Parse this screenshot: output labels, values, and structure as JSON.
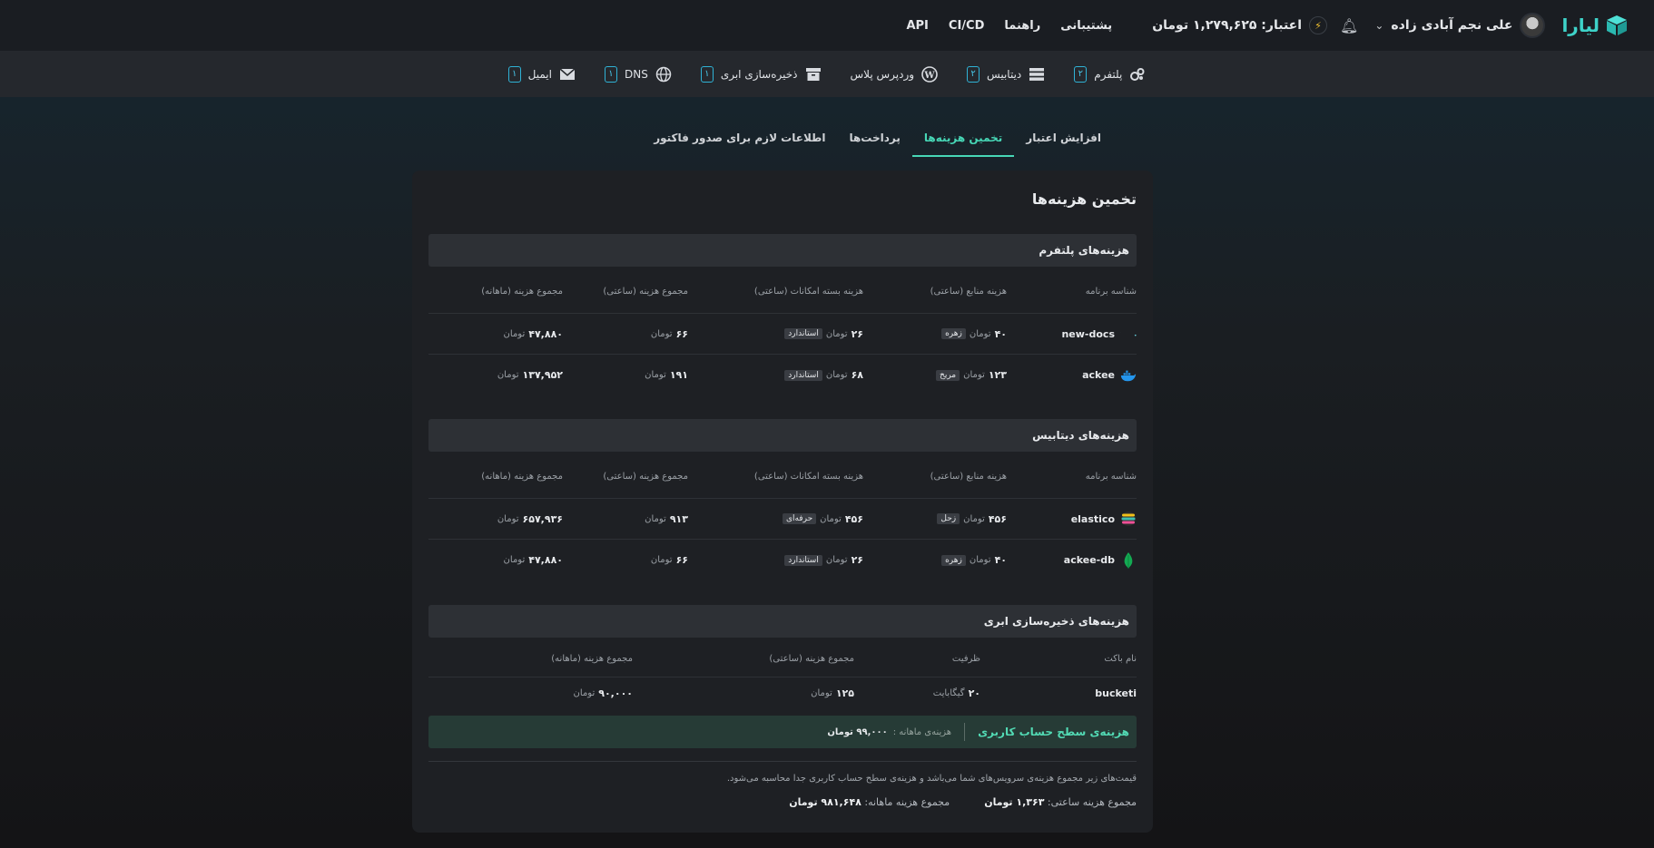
{
  "topbar": {
    "brand": "لیارا",
    "user_name": "علی نجم آبادی زاده",
    "credit": "اعتبار: ۱,۲۷۹,۶۲۵ تومان",
    "links": [
      "پشتیبانی",
      "راهنما",
      "CI/CD",
      "API"
    ]
  },
  "services": [
    {
      "label": "پلتفرم",
      "count": "۲",
      "icon": "cogs-icon"
    },
    {
      "label": "دیتابیس",
      "count": "۲",
      "icon": "database-icon"
    },
    {
      "label": "وردپرس پلاس",
      "count": "",
      "icon": "wordpress-icon"
    },
    {
      "label": "ذخیره‌سازی ابری",
      "count": "۱",
      "icon": "archive-icon"
    },
    {
      "label": "DNS",
      "count": "۱",
      "icon": "globe-icon"
    },
    {
      "label": "ایمیل",
      "count": "۱",
      "icon": "mail-icon"
    }
  ],
  "tabs": [
    {
      "label": "افزایش اعتبار",
      "active": false
    },
    {
      "label": "تخمین هزینه‌ها",
      "active": true
    },
    {
      "label": "پرداخت‌ها",
      "active": false
    },
    {
      "label": "اطلاعات لازم برای صدور فاکتور",
      "active": false
    }
  ],
  "card_title": "تخمین هزینه‌ها",
  "headers": {
    "app": "شناسه برنامه",
    "resource": "هزینه منابع (ساعتی)",
    "package": "هزینه بسته امکانات (ساعتی)",
    "hourly_total": "مجموع هزینه (ساعتی)",
    "monthly_total": "مجموع هزینه (ماهانه)"
  },
  "currency": "تومان",
  "platform": {
    "title": "هزینه‌های پلتفرم",
    "rows": [
      {
        "app": "new-docs",
        "icon": "nextjs-icon",
        "resource": "۴۰",
        "resource_plan": "زهره",
        "package": "۲۶",
        "package_plan": "استاندارد",
        "hourly": "۶۶",
        "monthly": "۴۷,۸۸۰"
      },
      {
        "app": "ackee",
        "icon": "docker-icon",
        "resource": "۱۲۳",
        "resource_plan": "مریخ",
        "package": "۶۸",
        "package_plan": "استاندارد",
        "hourly": "۱۹۱",
        "monthly": "۱۳۷,۹۵۲"
      }
    ]
  },
  "database": {
    "title": "هزینه‌های دیتابیس",
    "rows": [
      {
        "app": "elastico",
        "icon": "elastic-icon",
        "resource": "۴۵۶",
        "resource_plan": "زحل",
        "package": "۴۵۶",
        "package_plan": "حرفه‌ای",
        "hourly": "۹۱۳",
        "monthly": "۶۵۷,۹۳۶"
      },
      {
        "app": "ackee-db",
        "icon": "mongodb-icon",
        "resource": "۴۰",
        "resource_plan": "زهره",
        "package": "۲۶",
        "package_plan": "استاندارد",
        "hourly": "۶۶",
        "monthly": "۴۷,۸۸۰"
      }
    ]
  },
  "storage": {
    "title": "هزینه‌های ذخیره‌سازی ابری",
    "headers": {
      "bucket": "نام باکت",
      "capacity": "ظرفیت",
      "hourly": "مجموع هزینه (ساعتی)",
      "monthly": "مجموع هزینه (ماهانه)"
    },
    "rows": [
      {
        "bucket": "bucketi",
        "capacity": "۲۰",
        "capacity_unit": "گیگابایت",
        "hourly": "۱۲۵",
        "monthly": "۹۰,۰۰۰"
      }
    ]
  },
  "account_level": {
    "label": "هزینه‌ی سطح حساب کاربری",
    "monthly_label": "هزینه‌ی ماهانه :",
    "monthly_value": "۹۹,۰۰۰ تومان"
  },
  "footer": {
    "note": "قیمت‌های زیر مجموع هزینه‌ی سرویس‌های شما می‌باشد و هزینه‌ی سطح حساب کاربری جدا محاسبه می‌شود.",
    "hourly_label": "مجموع هزینه ساعتی:",
    "hourly_value": "۱,۳۶۳ تومان",
    "monthly_label": "مجموع هزینه ماهانه:",
    "monthly_value": "۹۸۱,۶۴۸ تومان"
  },
  "colors": {
    "accent": "#47d7b6",
    "badge": "#48c6e8",
    "brand": "#3ed3c9"
  }
}
